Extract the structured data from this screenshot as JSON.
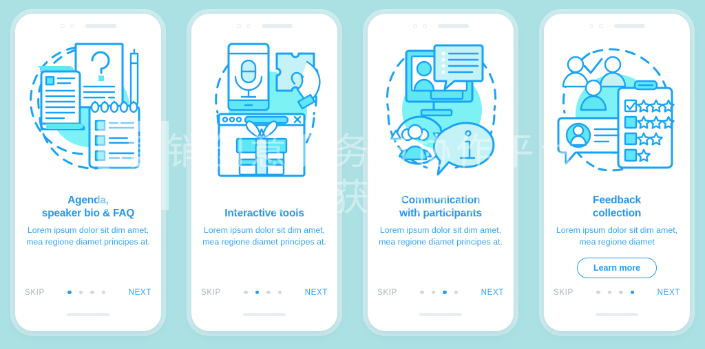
{
  "theme": {
    "background": "#ace1e4",
    "phone_bg": "#ffffff",
    "title_color": "#2497f2",
    "body_color": "#36a5ff",
    "accent": "#1f9bff",
    "skip_color": "#a9b3b8",
    "dot_inactive": "#cfd8dc",
    "illustration_line": "#19a3f7",
    "illustration_blob": "#7df2f5"
  },
  "watermark": {
    "line1": "营销创意服务与协作平台",
    "line2": "商用请获取授权"
  },
  "common": {
    "skip_label": "SKIP",
    "next_label": "NEXT",
    "dot_count": 4
  },
  "screens": [
    {
      "id": "agenda",
      "illustration": "agenda-documents-illustration",
      "title_lines": [
        "Agenda,",
        "speaker bio & FAQ"
      ],
      "body": "Lorem ipsum dolor sit dim amet, mea regione diamet principes at.",
      "cta": null,
      "active_dot": 0,
      "skip_label": "SKIP",
      "next_label": "NEXT"
    },
    {
      "id": "interactive-tools",
      "illustration": "microphone-puzzle-gift-illustration",
      "title_lines": [
        "Interactive tools"
      ],
      "body": "Lorem ipsum dolor sit dim amet, mea regione diamet principes at.",
      "cta": null,
      "active_dot": 1,
      "skip_label": "SKIP",
      "next_label": "NEXT"
    },
    {
      "id": "communication",
      "illustration": "monitor-chat-people-illustration",
      "title_lines": [
        "Communication",
        "with participants"
      ],
      "body": "Lorem ipsum dolor sit dim amet, mea regione diamet principes at.",
      "cta": null,
      "active_dot": 2,
      "skip_label": "SKIP",
      "next_label": "NEXT"
    },
    {
      "id": "feedback",
      "illustration": "rating-clipboard-people-illustration",
      "title_lines": [
        "Feedback",
        "collection"
      ],
      "body": "Lorem ipsum dolor sit dim amet, mea regione diamet",
      "cta": "Learn more",
      "active_dot": 3,
      "skip_label": "SKIP",
      "next_label": "NEXT"
    }
  ]
}
